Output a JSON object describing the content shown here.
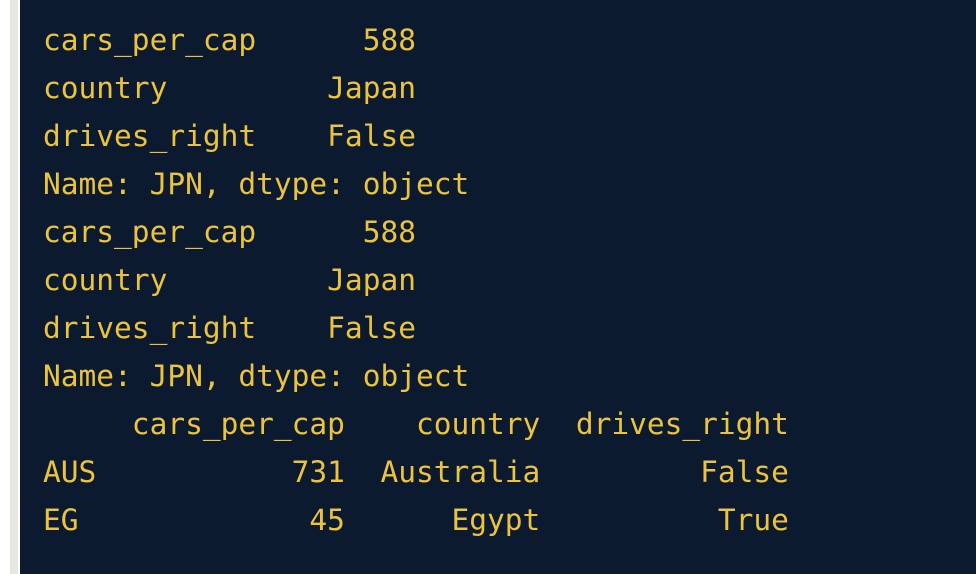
{
  "console": {
    "lines": [
      "cars_per_cap      588",
      "country         Japan",
      "drives_right    False",
      "Name: JPN, dtype: object",
      "cars_per_cap      588",
      "country         Japan",
      "drives_right    False",
      "Name: JPN, dtype: object",
      "     cars_per_cap    country  drives_right",
      "AUS           731  Australia         False",
      "EG             45      Egypt          True"
    ]
  },
  "colors": {
    "console_background": "#0b1a2e",
    "console_text": "#ecc33f",
    "page_background": "#ffffff",
    "left_rule": "#e6e6e2"
  }
}
